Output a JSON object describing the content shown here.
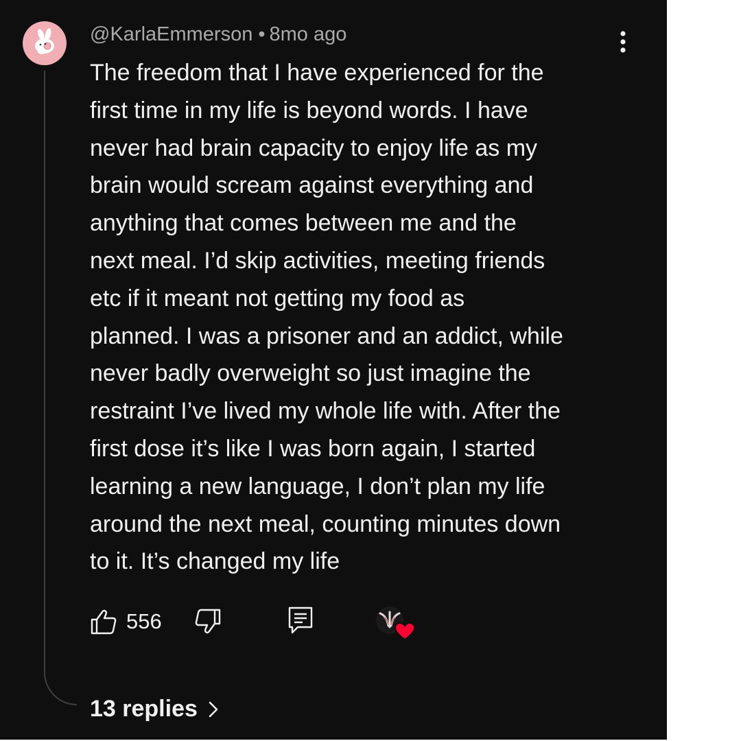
{
  "comment": {
    "author": "@KarlaEmmerson",
    "separator": "•",
    "time_ago": "8mo ago",
    "text": "The freedom that I have experienced for the\nfirst time in my life is beyond words. I have\nnever had brain capacity to enjoy life as my\nbrain would scream against everything and\nanything that comes between me and the\nnext meal. I’d skip activities, meeting friends\netc if it meant not getting my food as\nplanned. I was a prisoner and an addict, while\nnever badly overweight so just imagine the\nrestraint I’ve lived my whole life with. After the\nfirst dose it’s like I was born again, I started\nlearning a new language, I don’t plan my life\naround the next meal, counting minutes down\nto it. It’s changed my life",
    "like_count": "556",
    "replies_label": "13 replies"
  },
  "icons": {
    "avatar": "bunny-avatar-icon",
    "more": "more-vertical-icon",
    "like": "thumbs-up-icon",
    "dislike": "thumbs-down-icon",
    "reply": "reply-icon",
    "creator_heart": "creator-heart-icon",
    "replies_chevron": "chevron-right-icon"
  },
  "colors": {
    "background": "#0f0f0f",
    "primary_text": "#f1f1f1",
    "secondary_text": "#aaaaaa",
    "avatar_bg": "#f1aeb4",
    "heart": "#ff0033"
  }
}
